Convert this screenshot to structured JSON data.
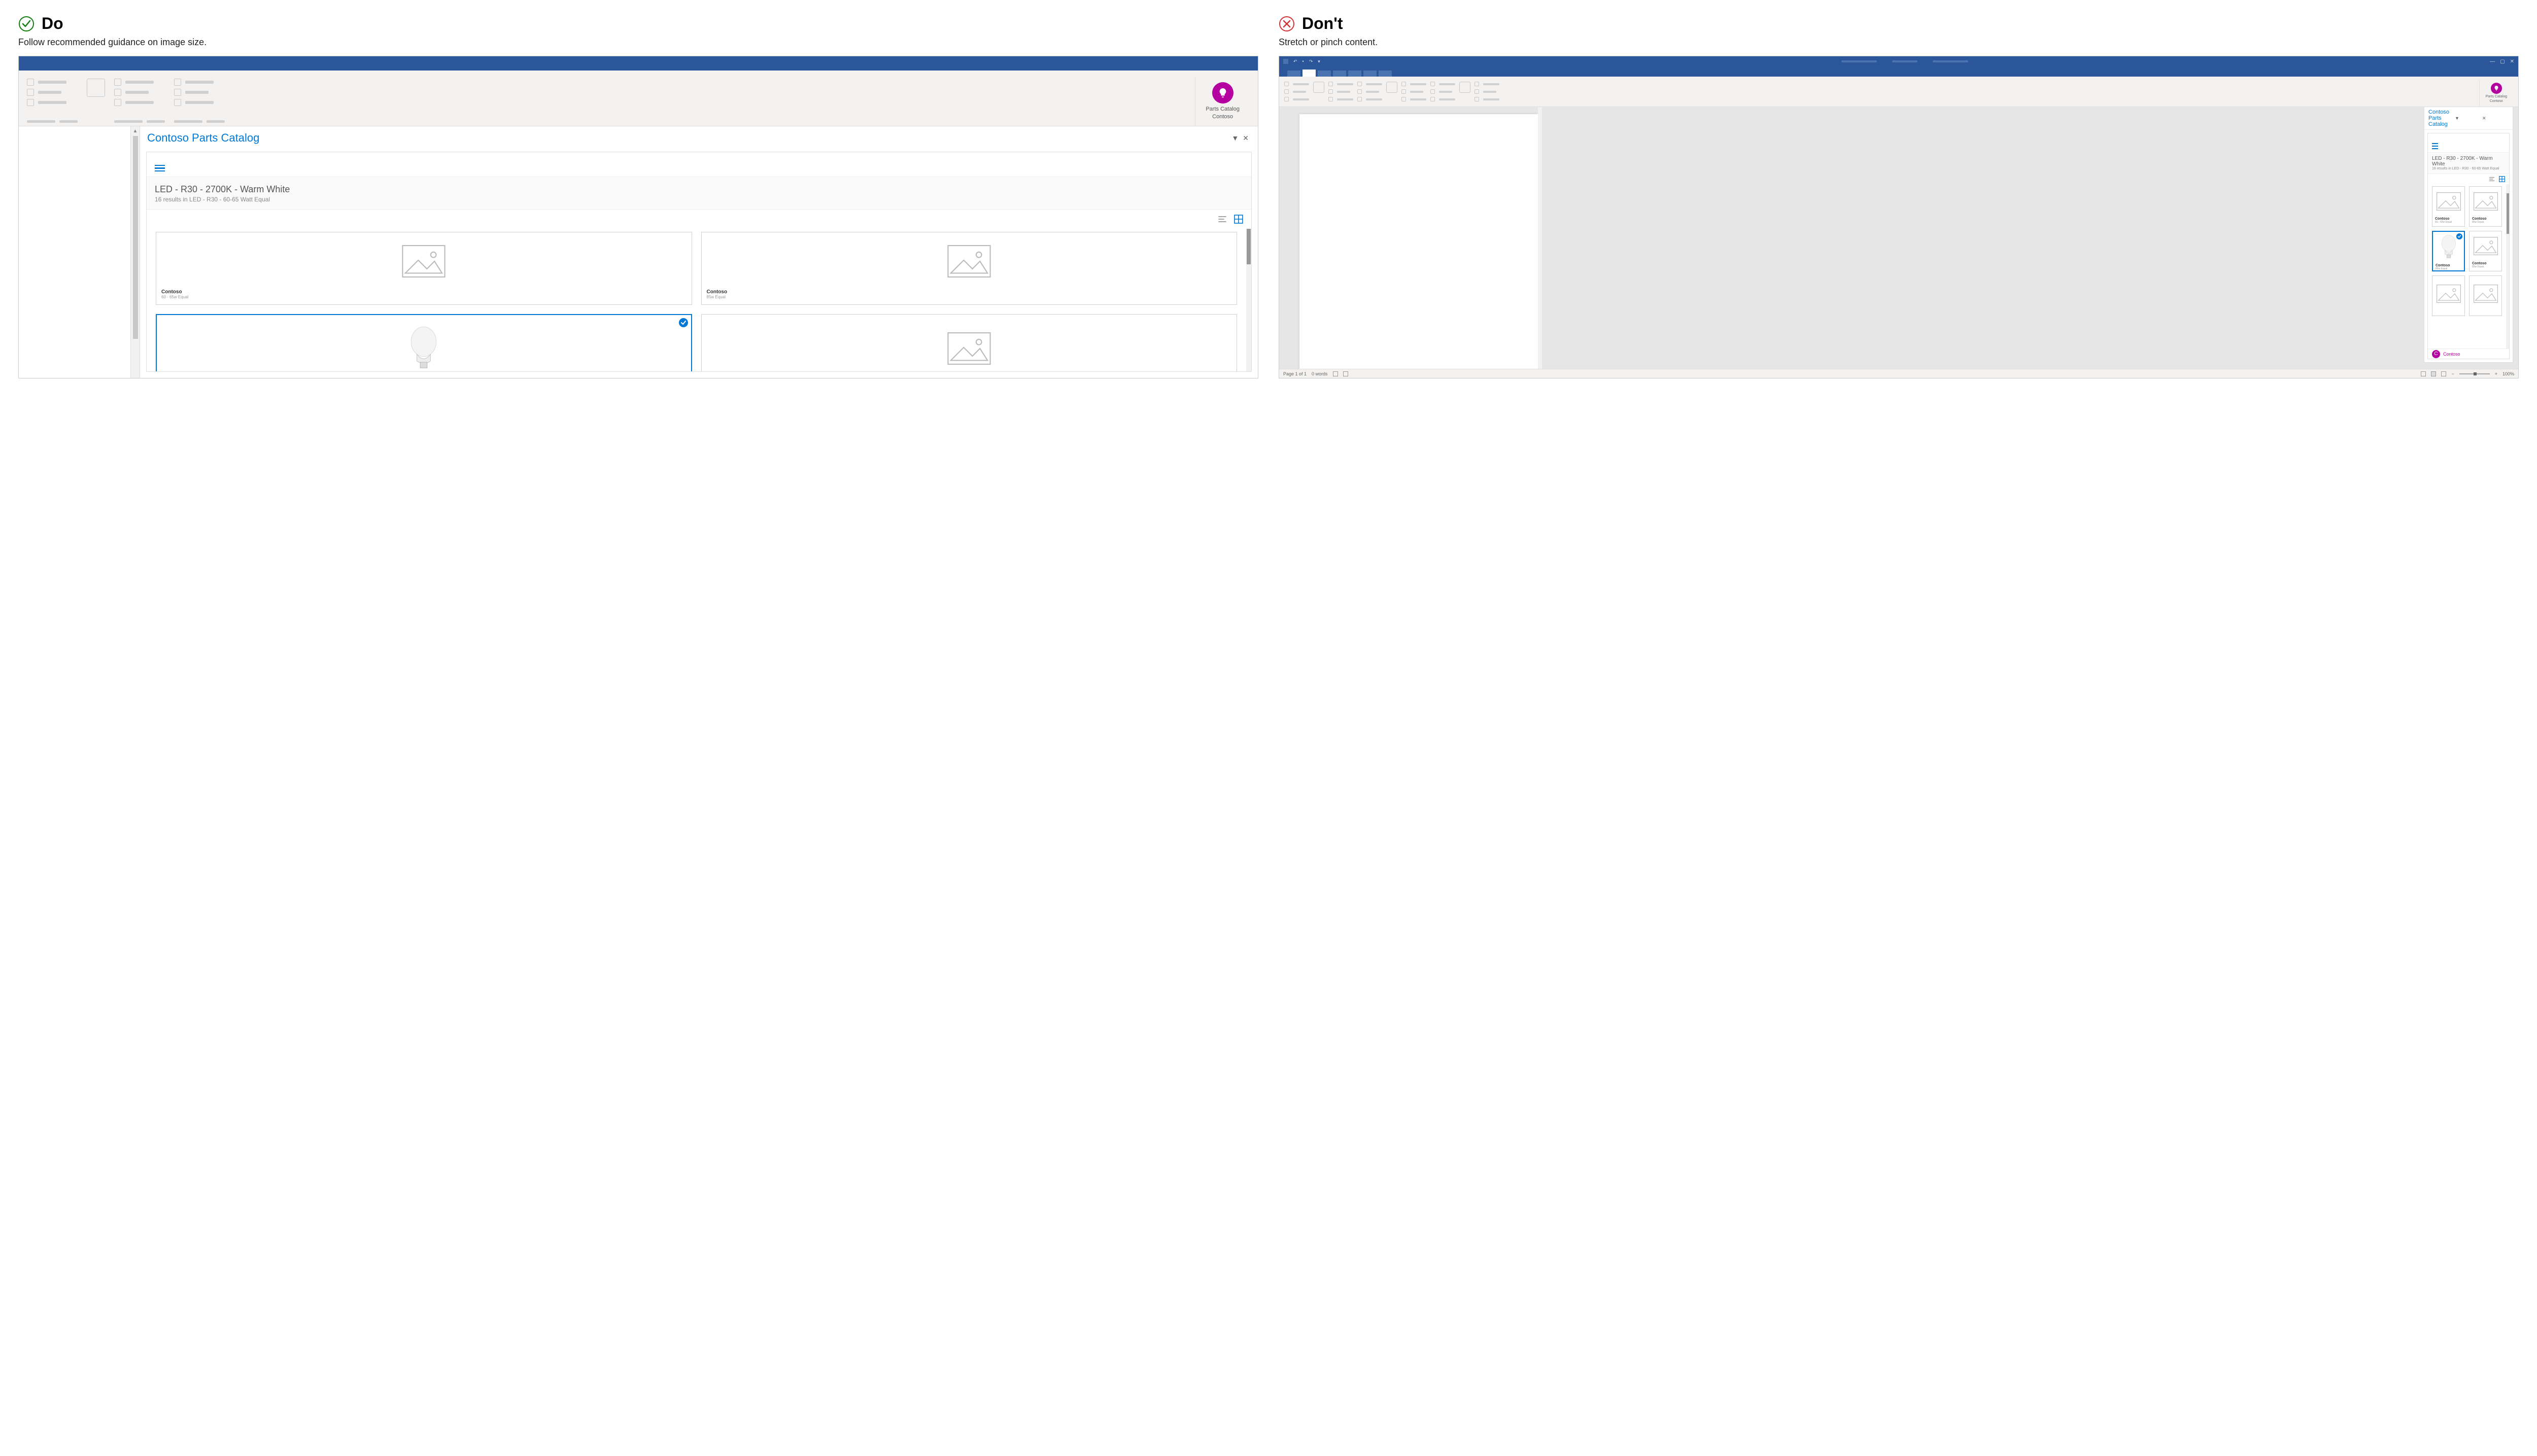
{
  "do": {
    "heading": "Do",
    "subheading": "Follow recommended guidance on image size.",
    "ribbon_button": {
      "line1": "Parts Catalog",
      "line2": "Contoso"
    },
    "taskpane": {
      "title": "Contoso Parts Catalog",
      "query_title": "LED - R30 - 2700K - Warm White",
      "query_sub": "16 results in LED - R30 - 60-65 Watt Equal",
      "cards": [
        {
          "brand": "Contoso",
          "meta": "60 - 65w Equal",
          "selected": false,
          "bulb": false
        },
        {
          "brand": "Contoso",
          "meta": "85w Equal",
          "selected": false,
          "bulb": false
        },
        {
          "brand": "",
          "meta": "",
          "selected": true,
          "bulb": true
        },
        {
          "brand": "",
          "meta": "",
          "selected": false,
          "bulb": false
        }
      ]
    }
  },
  "dont": {
    "heading": "Don't",
    "subheading": "Stretch or pinch content.",
    "ribbon_button": {
      "line1": "Parts Catalog",
      "line2": "Contoso"
    },
    "taskpane": {
      "title": "Contoso Parts Catalog",
      "query_title": "LED - R30 - 2700K - Warm White",
      "query_sub": "16 results in LED - R30 - 60-65 Watt Equal",
      "cards": [
        {
          "brand": "Contoso",
          "meta": "60 - 65w Equal",
          "selected": false,
          "bulb": false
        },
        {
          "brand": "Contoso",
          "meta": "85w Equal",
          "selected": false,
          "bulb": false
        },
        {
          "brand": "Contoso",
          "meta": "85w Equal",
          "selected": true,
          "bulb": true
        },
        {
          "brand": "Contoso",
          "meta": "85w Equal",
          "selected": false,
          "bulb": false
        },
        {
          "brand": "",
          "meta": "",
          "selected": false,
          "bulb": false
        },
        {
          "brand": "",
          "meta": "",
          "selected": false,
          "bulb": false
        }
      ],
      "footer_brand": "Contoso"
    },
    "status": {
      "page": "Page 1 of 1",
      "words": "0 words",
      "zoom": "100%"
    }
  }
}
